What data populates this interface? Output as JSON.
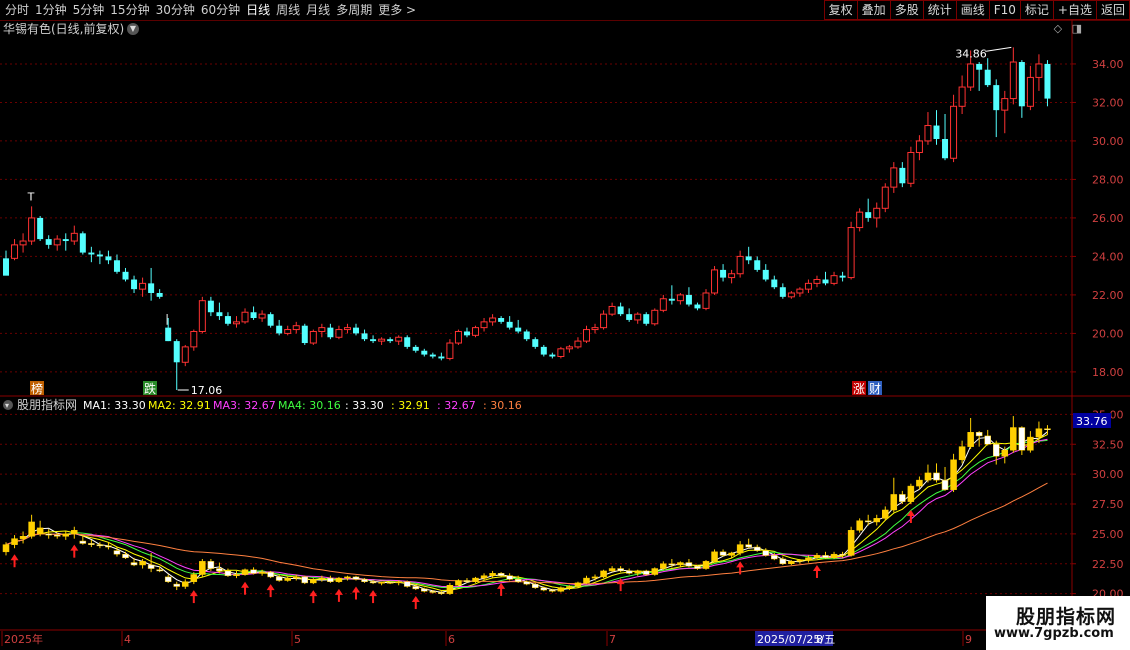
{
  "toolbar": {
    "tabs": [
      "分时",
      "1分钟",
      "5分钟",
      "15分钟",
      "30分钟",
      "60分钟",
      "日线",
      "周线",
      "月线",
      "多周期",
      "更多 >"
    ],
    "active_tab": "日线",
    "buttons": [
      "复权",
      "叠加",
      "多股",
      "统计",
      "画线",
      "F10",
      "+自选",
      "返回"
    ],
    "mark_button": "标记"
  },
  "stock": {
    "title": "华锡有色(日线,前复权)"
  },
  "main_chart": {
    "y_ticks": [
      "34.00",
      "32.00",
      "30.00",
      "28.00",
      "26.00",
      "24.00",
      "22.00",
      "20.00",
      "18.00"
    ],
    "y_min": 16.8,
    "y_max": 35.4,
    "high_label": "34.86",
    "low_label": "17.06",
    "badges": [
      "榜",
      "跌",
      "涨",
      "财"
    ],
    "t_marker": "T"
  },
  "indicator": {
    "name": "股朋指标网",
    "ma_labels": [
      {
        "text": "MA1: 33.30",
        "color": "#ffffff"
      },
      {
        "text": "MA2: 32.91",
        "color": "#ffff00"
      },
      {
        "text": "MA3: 32.67",
        "color": "#ff40ff"
      },
      {
        "text": "MA4: 30.16",
        "color": "#40ff40"
      },
      {
        "text": ": 33.30",
        "color": "#ffffff"
      },
      {
        "text": ": 32.91",
        "color": "#ffff00"
      },
      {
        "text": ": 32.67",
        "color": "#ff40ff"
      },
      {
        "text": ": 30.16",
        "color": "#ff8040"
      }
    ],
    "y_ticks": [
      "35.00",
      "32.50",
      "30.00",
      "27.50",
      "25.00",
      "22.50",
      "20.00"
    ],
    "current_value": "33.76",
    "y_min": 19.3,
    "y_max": 35.2
  },
  "x_axis": {
    "labels": [
      "2025年",
      "4",
      "5",
      "6",
      "7",
      "2025/07/25/五",
      "8",
      "9"
    ]
  },
  "chart_data": {
    "type": "candlestick",
    "candles": [
      [
        23.9,
        24.3,
        23.2,
        23.0
      ],
      [
        23.9,
        24.9,
        23.8,
        24.6
      ],
      [
        24.6,
        25.2,
        24.2,
        24.8
      ],
      [
        24.8,
        26.6,
        24.6,
        26.0
      ],
      [
        26.0,
        26.1,
        24.8,
        24.9
      ],
      [
        24.9,
        25.1,
        24.4,
        24.6
      ],
      [
        24.6,
        25.1,
        24.3,
        24.9
      ],
      [
        24.9,
        25.2,
        24.3,
        24.8
      ],
      [
        24.8,
        25.6,
        24.6,
        25.2
      ],
      [
        25.2,
        25.3,
        24.1,
        24.2
      ],
      [
        24.2,
        24.5,
        23.7,
        24.1
      ],
      [
        24.1,
        24.3,
        23.6,
        24.0
      ],
      [
        24.0,
        24.3,
        23.6,
        23.8
      ],
      [
        23.8,
        24.1,
        23.1,
        23.2
      ],
      [
        23.2,
        23.4,
        22.7,
        22.8
      ],
      [
        22.8,
        23.0,
        22.1,
        22.3
      ],
      [
        22.3,
        22.9,
        21.9,
        22.6
      ],
      [
        22.6,
        23.4,
        21.7,
        22.1
      ],
      [
        22.1,
        22.3,
        21.8,
        21.9
      ],
      [
        20.3,
        20.8,
        19.6,
        19.6
      ],
      [
        19.6,
        19.7,
        17.06,
        18.5
      ],
      [
        18.5,
        19.4,
        18.3,
        19.3
      ],
      [
        19.3,
        20.2,
        19.1,
        20.1
      ],
      [
        20.1,
        21.9,
        20.0,
        21.7
      ],
      [
        21.7,
        21.9,
        20.9,
        21.1
      ],
      [
        21.1,
        21.6,
        20.7,
        20.9
      ],
      [
        20.9,
        21.1,
        20.4,
        20.5
      ],
      [
        20.5,
        20.9,
        20.3,
        20.6
      ],
      [
        20.6,
        21.3,
        20.5,
        21.1
      ],
      [
        21.1,
        21.4,
        20.7,
        20.8
      ],
      [
        20.8,
        21.2,
        20.6,
        21.0
      ],
      [
        21.0,
        21.1,
        20.3,
        20.4
      ],
      [
        20.4,
        20.7,
        19.9,
        20.0
      ],
      [
        20.0,
        20.4,
        19.9,
        20.2
      ],
      [
        20.2,
        20.6,
        20.0,
        20.4
      ],
      [
        20.4,
        20.5,
        19.4,
        19.5
      ],
      [
        19.5,
        20.2,
        19.4,
        20.1
      ],
      [
        20.1,
        20.5,
        19.8,
        20.3
      ],
      [
        20.3,
        20.5,
        19.7,
        19.8
      ],
      [
        19.8,
        20.4,
        19.7,
        20.2
      ],
      [
        20.2,
        20.5,
        20.0,
        20.3
      ],
      [
        20.3,
        20.5,
        19.9,
        20.0
      ],
      [
        20.0,
        20.2,
        19.6,
        19.7
      ],
      [
        19.7,
        19.9,
        19.5,
        19.6
      ],
      [
        19.6,
        19.8,
        19.4,
        19.7
      ],
      [
        19.7,
        19.8,
        19.5,
        19.6
      ],
      [
        19.6,
        19.9,
        19.4,
        19.8
      ],
      [
        19.8,
        19.9,
        19.2,
        19.3
      ],
      [
        19.3,
        19.4,
        19.0,
        19.1
      ],
      [
        19.1,
        19.2,
        18.8,
        18.9
      ],
      [
        18.9,
        19.0,
        18.7,
        18.8
      ],
      [
        18.8,
        19.0,
        18.6,
        18.7
      ],
      [
        18.7,
        19.7,
        18.6,
        19.5
      ],
      [
        19.5,
        20.2,
        19.4,
        20.1
      ],
      [
        20.1,
        20.3,
        19.8,
        19.9
      ],
      [
        19.9,
        20.4,
        19.8,
        20.3
      ],
      [
        20.3,
        20.8,
        20.1,
        20.6
      ],
      [
        20.6,
        21.0,
        20.4,
        20.8
      ],
      [
        20.8,
        20.9,
        20.5,
        20.6
      ],
      [
        20.6,
        20.9,
        20.2,
        20.3
      ],
      [
        20.3,
        20.7,
        20.0,
        20.1
      ],
      [
        20.1,
        20.2,
        19.6,
        19.7
      ],
      [
        19.7,
        19.8,
        19.2,
        19.3
      ],
      [
        19.3,
        19.4,
        18.8,
        18.9
      ],
      [
        18.9,
        19.0,
        18.7,
        18.8
      ],
      [
        18.8,
        19.3,
        18.7,
        19.2
      ],
      [
        19.2,
        19.4,
        19.0,
        19.3
      ],
      [
        19.3,
        19.8,
        19.2,
        19.6
      ],
      [
        19.6,
        20.4,
        19.5,
        20.2
      ],
      [
        20.2,
        20.5,
        20.0,
        20.3
      ],
      [
        20.3,
        21.2,
        20.2,
        21.0
      ],
      [
        21.0,
        21.6,
        20.9,
        21.4
      ],
      [
        21.4,
        21.6,
        20.9,
        21.0
      ],
      [
        21.0,
        21.3,
        20.6,
        20.7
      ],
      [
        20.7,
        21.1,
        20.5,
        21.0
      ],
      [
        21.0,
        21.1,
        20.4,
        20.5
      ],
      [
        20.5,
        21.3,
        20.4,
        21.2
      ],
      [
        21.2,
        22.0,
        21.1,
        21.8
      ],
      [
        21.8,
        22.5,
        21.5,
        21.7
      ],
      [
        21.7,
        22.1,
        21.5,
        22.0
      ],
      [
        22.0,
        22.4,
        21.4,
        21.5
      ],
      [
        21.5,
        21.6,
        21.2,
        21.3
      ],
      [
        21.3,
        22.3,
        21.2,
        22.1
      ],
      [
        22.1,
        23.5,
        22.0,
        23.3
      ],
      [
        23.3,
        23.6,
        22.7,
        22.9
      ],
      [
        22.9,
        23.3,
        22.6,
        23.1
      ],
      [
        23.1,
        24.3,
        22.9,
        24.0
      ],
      [
        24.0,
        24.5,
        23.6,
        23.8
      ],
      [
        23.8,
        24.0,
        23.2,
        23.3
      ],
      [
        23.3,
        23.6,
        22.7,
        22.8
      ],
      [
        22.8,
        23.0,
        22.3,
        22.4
      ],
      [
        22.4,
        22.6,
        21.8,
        21.9
      ],
      [
        21.9,
        22.2,
        21.8,
        22.1
      ],
      [
        22.1,
        22.4,
        21.9,
        22.3
      ],
      [
        22.3,
        22.8,
        22.1,
        22.6
      ],
      [
        22.6,
        23.0,
        22.4,
        22.8
      ],
      [
        22.8,
        23.2,
        22.5,
        22.6
      ],
      [
        22.6,
        23.2,
        22.5,
        23.0
      ],
      [
        23.0,
        23.2,
        22.7,
        22.9
      ],
      [
        22.9,
        25.8,
        22.8,
        25.5
      ],
      [
        25.5,
        26.5,
        25.3,
        26.3
      ],
      [
        26.3,
        27.0,
        25.8,
        26.0
      ],
      [
        26.0,
        26.8,
        25.5,
        26.5
      ],
      [
        26.5,
        27.8,
        26.3,
        27.6
      ],
      [
        27.6,
        28.9,
        27.3,
        28.6
      ],
      [
        28.6,
        28.9,
        27.6,
        27.8
      ],
      [
        27.8,
        29.7,
        27.6,
        29.4
      ],
      [
        29.4,
        30.3,
        29.0,
        30.0
      ],
      [
        30.0,
        31.5,
        29.8,
        30.8
      ],
      [
        30.8,
        31.6,
        29.8,
        30.1
      ],
      [
        30.1,
        31.4,
        29.0,
        29.1
      ],
      [
        29.1,
        32.4,
        28.9,
        31.8
      ],
      [
        31.8,
        33.4,
        31.4,
        32.8
      ],
      [
        32.8,
        34.7,
        32.6,
        34.0
      ],
      [
        34.0,
        34.1,
        32.6,
        33.7
      ],
      [
        33.7,
        34.3,
        32.8,
        32.9
      ],
      [
        32.9,
        33.2,
        30.2,
        31.6
      ],
      [
        31.6,
        32.6,
        30.4,
        32.2
      ],
      [
        32.2,
        34.86,
        31.9,
        34.1
      ],
      [
        34.1,
        34.2,
        31.2,
        31.8
      ],
      [
        31.8,
        33.9,
        31.6,
        33.3
      ],
      [
        33.3,
        34.5,
        32.6,
        34.0
      ],
      [
        34.0,
        34.2,
        31.8,
        32.2
      ]
    ],
    "ind_candles": [
      [
        23.5,
        24.3,
        23.2,
        24.1
      ],
      [
        24.1,
        24.9,
        23.8,
        24.6
      ],
      [
        24.6,
        25.2,
        24.2,
        24.8
      ],
      [
        24.8,
        26.6,
        24.6,
        26.0
      ],
      [
        25.0,
        26.1,
        24.8,
        25.5
      ],
      [
        25.0,
        25.4,
        24.6,
        24.9
      ],
      [
        24.9,
        25.1,
        24.6,
        24.8
      ],
      [
        24.8,
        25.2,
        24.5,
        25.0
      ],
      [
        25.0,
        25.6,
        24.6,
        25.3
      ],
      [
        24.4,
        24.8,
        24.1,
        24.2
      ],
      [
        24.2,
        24.5,
        23.9,
        24.1
      ],
      [
        24.1,
        24.3,
        23.8,
        24.0
      ],
      [
        24.0,
        24.3,
        23.7,
        23.9
      ],
      [
        23.6,
        23.9,
        23.1,
        23.3
      ],
      [
        23.3,
        23.5,
        22.9,
        23.0
      ],
      [
        22.6,
        23.0,
        22.3,
        22.4
      ],
      [
        22.4,
        22.9,
        22.1,
        22.7
      ],
      [
        22.4,
        23.4,
        21.8,
        22.1
      ],
      [
        22.0,
        22.3,
        21.8,
        21.9
      ],
      [
        21.4,
        21.6,
        20.9,
        21.0
      ],
      [
        20.8,
        21.0,
        20.3,
        20.6
      ],
      [
        20.6,
        21.2,
        20.4,
        21.0
      ],
      [
        21.0,
        21.8,
        20.8,
        21.6
      ],
      [
        21.6,
        22.9,
        21.4,
        22.7
      ],
      [
        22.7,
        22.9,
        21.9,
        22.1
      ],
      [
        22.1,
        22.6,
        21.7,
        21.9
      ],
      [
        21.9,
        22.1,
        21.4,
        21.5
      ],
      [
        21.5,
        21.9,
        21.3,
        21.6
      ],
      [
        21.6,
        22.1,
        21.5,
        22.0
      ],
      [
        22.0,
        22.2,
        21.6,
        21.7
      ],
      [
        21.7,
        22.0,
        21.5,
        21.8
      ],
      [
        21.8,
        21.9,
        21.3,
        21.4
      ],
      [
        21.4,
        21.6,
        21.0,
        21.1
      ],
      [
        21.1,
        21.4,
        21.0,
        21.3
      ],
      [
        21.3,
        21.6,
        21.1,
        21.4
      ],
      [
        21.4,
        21.5,
        20.8,
        20.9
      ],
      [
        20.9,
        21.3,
        20.8,
        21.2
      ],
      [
        21.2,
        21.5,
        21.0,
        21.3
      ],
      [
        21.3,
        21.5,
        20.9,
        21.0
      ],
      [
        21.0,
        21.4,
        20.9,
        21.3
      ],
      [
        21.3,
        21.5,
        21.1,
        21.4
      ],
      [
        21.4,
        21.5,
        21.1,
        21.2
      ],
      [
        21.2,
        21.3,
        20.9,
        21.0
      ],
      [
        21.0,
        21.1,
        20.8,
        20.9
      ],
      [
        20.9,
        21.0,
        20.7,
        20.95
      ],
      [
        20.95,
        21.0,
        20.8,
        20.9
      ],
      [
        20.9,
        21.1,
        20.7,
        21.0
      ],
      [
        21.0,
        21.1,
        20.5,
        20.6
      ],
      [
        20.6,
        20.7,
        20.3,
        20.4
      ],
      [
        20.4,
        20.5,
        20.1,
        20.2
      ],
      [
        20.2,
        20.3,
        20.0,
        20.1
      ],
      [
        20.1,
        20.3,
        19.9,
        20.0
      ],
      [
        20.0,
        20.9,
        19.9,
        20.7
      ],
      [
        20.7,
        21.2,
        20.6,
        21.1
      ],
      [
        21.1,
        21.3,
        20.9,
        21.0
      ],
      [
        21.0,
        21.4,
        20.9,
        21.3
      ],
      [
        21.3,
        21.7,
        21.1,
        21.5
      ],
      [
        21.5,
        21.9,
        21.3,
        21.7
      ],
      [
        21.7,
        21.8,
        21.4,
        21.5
      ],
      [
        21.5,
        21.7,
        21.1,
        21.2
      ],
      [
        21.2,
        21.5,
        20.9,
        21.0
      ],
      [
        21.0,
        21.1,
        20.7,
        20.8
      ],
      [
        20.8,
        20.9,
        20.4,
        20.5
      ],
      [
        20.5,
        20.6,
        20.2,
        20.3
      ],
      [
        20.3,
        20.4,
        20.1,
        20.2
      ],
      [
        20.2,
        20.6,
        20.1,
        20.5
      ],
      [
        20.5,
        20.7,
        20.3,
        20.6
      ],
      [
        20.6,
        21.0,
        20.5,
        20.9
      ],
      [
        20.9,
        21.5,
        20.8,
        21.3
      ],
      [
        21.3,
        21.6,
        21.1,
        21.4
      ],
      [
        21.4,
        22.0,
        21.3,
        21.9
      ],
      [
        21.9,
        22.3,
        21.8,
        22.1
      ],
      [
        22.1,
        22.3,
        21.8,
        21.9
      ],
      [
        21.9,
        22.1,
        21.6,
        21.7
      ],
      [
        21.7,
        22.0,
        21.5,
        21.9
      ],
      [
        21.9,
        22.0,
        21.5,
        21.6
      ],
      [
        21.6,
        22.2,
        21.5,
        22.1
      ],
      [
        22.1,
        22.7,
        22.0,
        22.5
      ],
      [
        22.5,
        22.9,
        22.2,
        22.4
      ],
      [
        22.4,
        22.7,
        22.2,
        22.6
      ],
      [
        22.6,
        22.9,
        22.2,
        22.3
      ],
      [
        22.3,
        22.4,
        22.0,
        22.1
      ],
      [
        22.1,
        22.8,
        22.0,
        22.7
      ],
      [
        22.7,
        23.7,
        22.6,
        23.5
      ],
      [
        23.5,
        23.7,
        23.1,
        23.2
      ],
      [
        23.2,
        23.5,
        23.0,
        23.4
      ],
      [
        23.4,
        24.4,
        23.2,
        24.1
      ],
      [
        24.1,
        24.6,
        23.8,
        23.9
      ],
      [
        23.9,
        24.1,
        23.5,
        23.6
      ],
      [
        23.6,
        23.8,
        23.1,
        23.2
      ],
      [
        23.2,
        23.4,
        22.8,
        22.9
      ],
      [
        22.9,
        23.1,
        22.4,
        22.5
      ],
      [
        22.5,
        22.8,
        22.4,
        22.7
      ],
      [
        22.7,
        22.9,
        22.5,
        22.8
      ],
      [
        22.8,
        23.2,
        22.6,
        23.0
      ],
      [
        23.0,
        23.4,
        22.9,
        23.2
      ],
      [
        23.2,
        23.5,
        22.9,
        23.0
      ],
      [
        23.0,
        23.5,
        22.9,
        23.3
      ],
      [
        23.3,
        23.5,
        23.0,
        23.2
      ],
      [
        23.2,
        25.6,
        23.1,
        25.3
      ],
      [
        25.3,
        26.3,
        25.1,
        26.1
      ],
      [
        26.1,
        26.6,
        25.7,
        26.0
      ],
      [
        26.0,
        26.6,
        25.7,
        26.3
      ],
      [
        26.3,
        27.3,
        26.1,
        27.0
      ],
      [
        27.0,
        29.7,
        26.8,
        28.3
      ],
      [
        28.3,
        28.6,
        27.5,
        27.7
      ],
      [
        27.7,
        29.2,
        27.5,
        29.0
      ],
      [
        29.0,
        29.8,
        28.7,
        29.5
      ],
      [
        29.5,
        30.8,
        29.3,
        30.1
      ],
      [
        30.1,
        30.9,
        29.3,
        29.5
      ],
      [
        29.5,
        30.6,
        28.6,
        28.7
      ],
      [
        28.7,
        31.7,
        28.5,
        31.2
      ],
      [
        31.2,
        32.8,
        30.9,
        32.3
      ],
      [
        32.3,
        34.7,
        32.1,
        33.5
      ],
      [
        33.5,
        33.6,
        32.3,
        33.2
      ],
      [
        33.2,
        33.7,
        32.4,
        32.5
      ],
      [
        32.5,
        32.8,
        30.8,
        31.5
      ],
      [
        31.5,
        32.3,
        30.9,
        32.0
      ],
      [
        32.0,
        34.86,
        31.8,
        33.9
      ],
      [
        33.9,
        34.0,
        31.6,
        32.0
      ],
      [
        32.0,
        33.6,
        31.8,
        33.1
      ],
      [
        33.1,
        34.4,
        32.6,
        33.8
      ],
      [
        33.8,
        34.1,
        33.3,
        33.76
      ]
    ],
    "arrows_at": [
      1,
      8,
      22,
      28,
      31,
      36,
      39,
      41,
      43,
      48,
      58,
      72,
      86,
      95,
      106
    ],
    "ma_colors": {
      "MA1": "#ffffff",
      "MA2": "#ffff00",
      "MA3": "#ff40ff",
      "MA4": "#40ff40",
      "ma_long": "#ff8040"
    }
  },
  "watermark": {
    "line1": "股朋指标网",
    "line2": "www.7gpzb.com"
  }
}
